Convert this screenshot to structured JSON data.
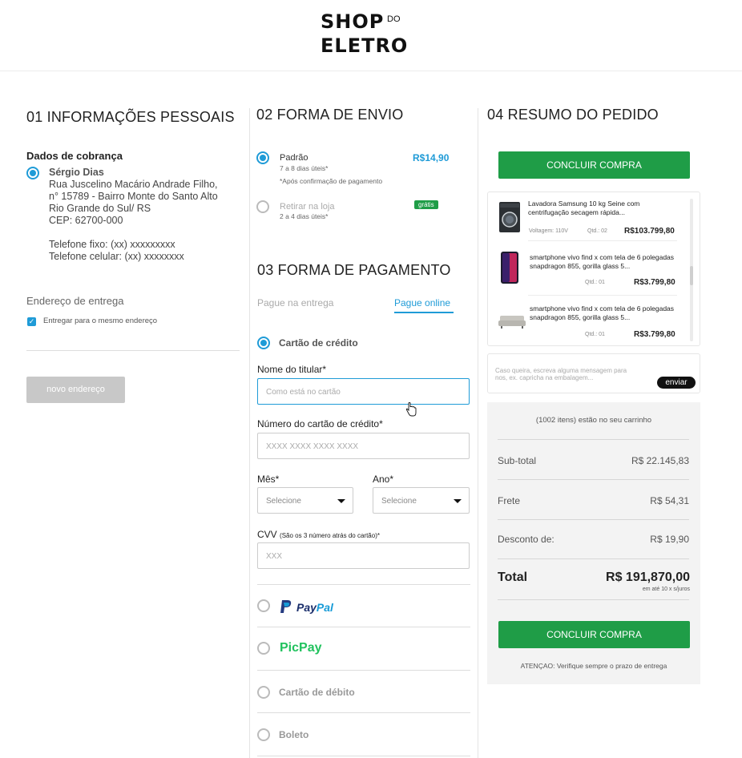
{
  "brand": {
    "name_line1": "SHOP",
    "name_small": "DO",
    "name_line2": "ELETRO"
  },
  "personal": {
    "title": "01 INFORMAÇÕES PESSOAIS",
    "billing_title": "Dados de cobrança",
    "billing": {
      "name": "Sérgio Dias",
      "street": "Rua Juscelino Macário Andrade Filho,",
      "number": "n° 15789 - Bairro Monte do Santo Alto",
      "city": "Rio Grande do Sul/ RS",
      "cep": "CEP: 62700-000",
      "phone": "Telefone fixo: (xx) xxxxxxxxx",
      "mobile": "Telefone celular: (xx) xxxxxxxx"
    },
    "delivery_title": "Endereço de entrega",
    "same_address_label": "Entregar para o mesmo endereço",
    "new_address_button": "novo endereço"
  },
  "shipping": {
    "title": "02 FORMA DE ENVIO",
    "options": [
      {
        "label": "Padrão",
        "sub": "7 a 8 dias úteis*",
        "note": "*Após confirmação de pagamento",
        "price": "R$14,90"
      },
      {
        "label": "Retirar na loja",
        "sub": "2 a 4 dias úteis*",
        "badge": "grátis"
      }
    ]
  },
  "payment": {
    "title": "03 FORMA DE PAGAMENTO",
    "tabs": [
      "Pague na entrega",
      "Pague online"
    ],
    "credit_card_label": "Cartão de crédito",
    "holder_label": "Nome do titular*",
    "holder_placeholder": "Como está no cartão",
    "number_label": "Número do cartão de crédito*",
    "number_placeholder": "XXXX  XXXX  XXXX  XXXX",
    "month_label": "Mês*",
    "year_label": "Ano*",
    "select_placeholder": "Selecione",
    "cvv_label": "CVV",
    "cvv_hint": "(São os 3 número atrás do cartão)*",
    "cvv_placeholder": "XXX",
    "paypal_label": "PayPal",
    "paypal_pay": "Pay",
    "paypal_pal": "Pal",
    "picpay_label": "PicPay",
    "debit_label": "Cartão de débito",
    "boleto_label": "Boleto"
  },
  "summary": {
    "title": "04 RESUMO DO PEDIDO",
    "checkout_button": "CONCLUIR COMPRA",
    "items": [
      {
        "name": "Lavadora Samsung 10 kg Seine com centrifugação secagem rápida...",
        "voltage": "Voltagem: 110V",
        "qty": "Qtd.: 02",
        "price": "R$103.799,80",
        "icon": "washing-machine-icon"
      },
      {
        "name": "smartphone vivo find x com tela de 6 polegadas snapdragon 855, gorilla glass 5...",
        "qty": "Qtd.: 01",
        "price": "R$3.799,80",
        "icon": "smartphone-icon"
      },
      {
        "name": "smartphone vivo find x com tela de 6 polegadas snapdragon 855, gorilla glass 5...",
        "qty": "Qtd.: 01",
        "price": "R$3.799,80",
        "icon": "sofa-icon"
      }
    ],
    "message_placeholder": "Caso queira, escreva alguma mensagem para nos, ex. capricha na embalagem...",
    "send_button": "enviar",
    "cart_count": "(1002 itens) estão no seu carrinho",
    "subtotal_label": "Sub-total",
    "subtotal": "R$ 22.145,83",
    "shipping_label": "Frete",
    "shipping": "R$ 54,31",
    "discount_label": "Desconto de:",
    "discount": "R$ 19,90",
    "total_label": "Total",
    "total": "R$ 191,870,00",
    "installments": "em até 10 x s/juros",
    "warning": "ATENÇAO: Verifique sempre o prazo de entrega"
  },
  "colors": {
    "accent": "#1f9bd7",
    "green": "#1f9d47",
    "paypal": "#253b80",
    "picpay": "#21c25e"
  }
}
